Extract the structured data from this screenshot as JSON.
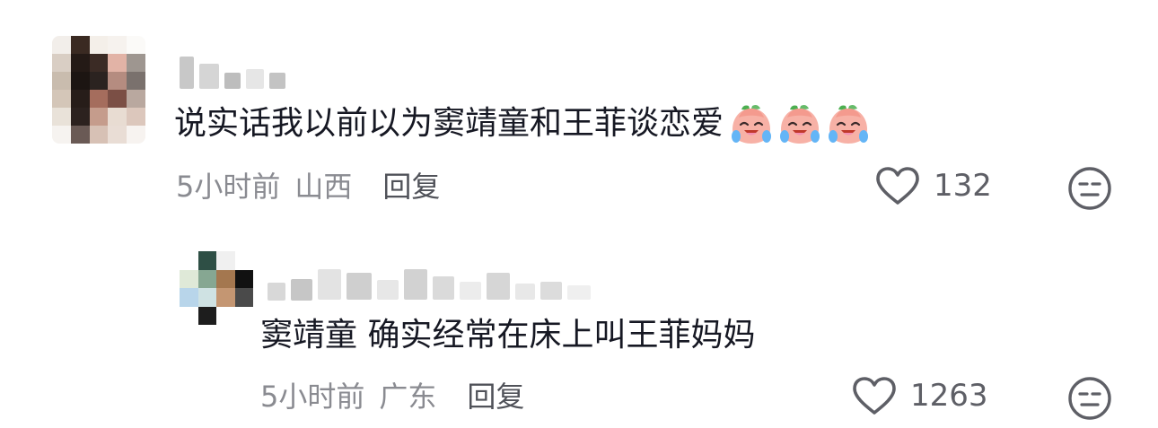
{
  "comments": [
    {
      "text": "说实话我以前以为窦靖童和王菲谈恋爱",
      "time": "5小时前",
      "location": "山西",
      "reply_label": "回复",
      "likes": "132",
      "emoji_icons": [
        "crying-laughing-peach-emoji",
        "crying-laughing-peach-emoji",
        "crying-laughing-peach-emoji"
      ]
    },
    {
      "text": "窦靖童 确实经常在床上叫王菲妈妈",
      "time": "5小时前",
      "location": "广东",
      "reply_label": "回复",
      "likes": "1263"
    }
  ],
  "icons": {
    "like": "heart-outline-icon",
    "dislike": "meh-face-icon"
  },
  "colors": {
    "text_primary": "#161823",
    "text_secondary": "#8a8b91",
    "reply_action": "#505259",
    "icon": "#5e5f66"
  }
}
